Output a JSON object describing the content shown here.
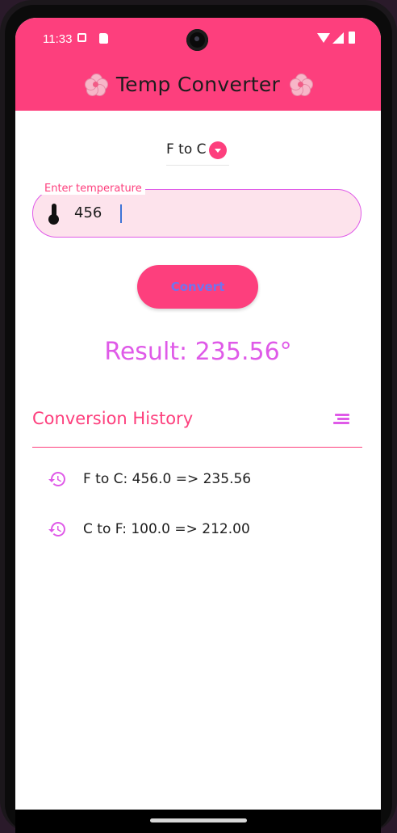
{
  "status_bar": {
    "time": "11:33"
  },
  "app_bar": {
    "title": "Temp Converter",
    "background": "#fd3f7d"
  },
  "dropdown": {
    "selected": "F to C"
  },
  "temperature_input": {
    "label": "Enter temperature",
    "value": "456"
  },
  "convert_button": {
    "label": "Convert"
  },
  "result": {
    "text": "Result: 235.56°"
  },
  "history": {
    "title": "Conversion History",
    "items": [
      {
        "text": "F to C: 456.0 => 235.56"
      },
      {
        "text": "C to F: 100.0 => 212.00"
      }
    ]
  },
  "colors": {
    "primary": "#fd3f7d",
    "accent": "#df5ae8",
    "field_fill": "#fde3ec",
    "button_text": "#6f74ef"
  },
  "icons": [
    "sim-icon",
    "sd-card-icon",
    "camera-icon",
    "wifi-icon",
    "signal-icon",
    "battery-icon",
    "cherry-blossom-icon",
    "dropdown-caret-icon",
    "thermometer-icon",
    "sort-icon",
    "history-icon"
  ]
}
